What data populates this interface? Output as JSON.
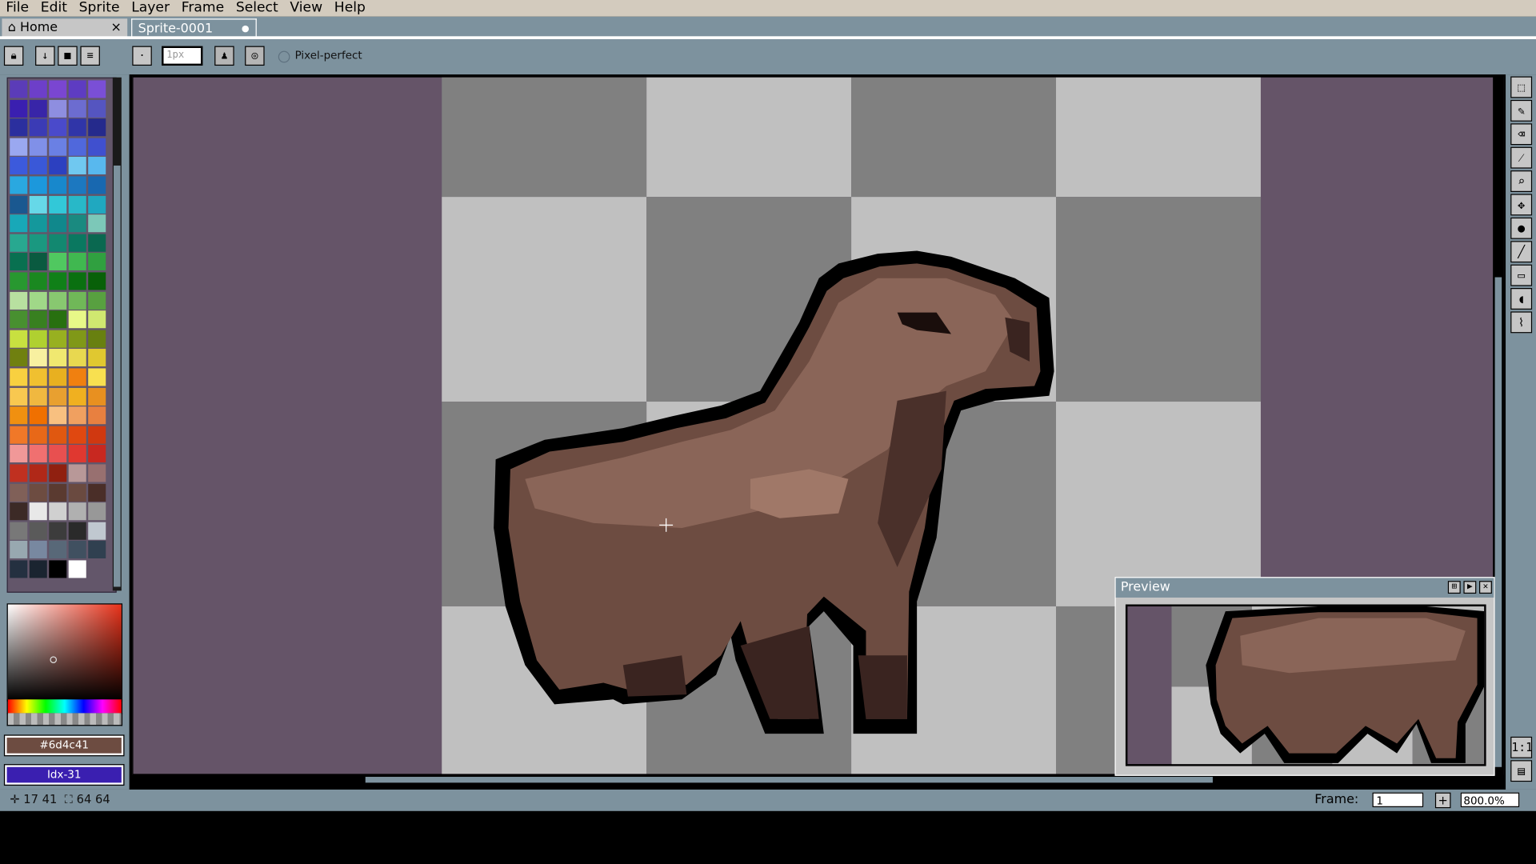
{
  "menu": [
    "File",
    "Edit",
    "Sprite",
    "Layer",
    "Frame",
    "Select",
    "View",
    "Help"
  ],
  "tabs": {
    "home": "Home",
    "sprite": "Sprite-0001",
    "home_close": "×"
  },
  "toolbar": {
    "brush_size": "1px",
    "pixel_perfect": "Pixel-perfect"
  },
  "color": {
    "hex": "#6d4c41",
    "index": "Idx-31"
  },
  "status": {
    "cursor": "17 41",
    "sprite_size": "64 64",
    "frame_label": "Frame:",
    "frame_value": "1",
    "zoom": "800.0%"
  },
  "preview": {
    "title": "Preview"
  },
  "colors": {
    "canvas_bg": "#655468",
    "ui": "#7d929e",
    "menubar": "#d3cbbe",
    "sprite_main": "#6d4c41"
  }
}
